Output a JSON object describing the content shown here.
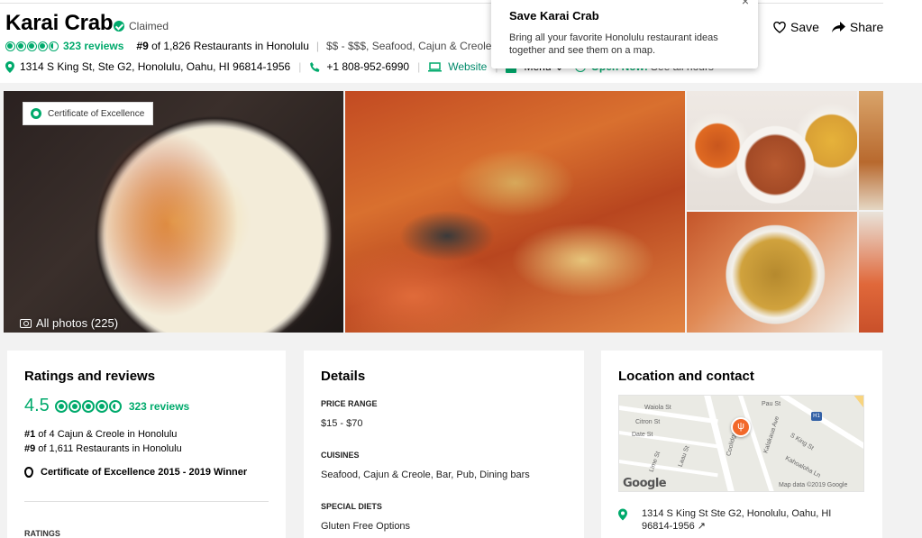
{
  "header": {
    "title": "Karai Crab",
    "claimed_label": "Claimed",
    "reviews_count": "323 reviews",
    "rank_num": "#9",
    "rank_text": " of 1,826 Restaurants in Honolulu",
    "categories": "$$ - $$$, Seafood, Cajun & Creole, Bar",
    "address": "1314 S King St, Ste G2, Honolulu, Oahu, HI 96814-1956",
    "phone": "+1 808-952-6990",
    "website_label": "Website",
    "menu_label": "Menu",
    "open_now_label": "Open Now:",
    "see_hours_label": "See all hours",
    "save_label": "Save",
    "share_label": "Share",
    "rating_bubbles": 4.5,
    "accent_color": "#00aa6c"
  },
  "popup": {
    "title": "Save Karai Crab",
    "body": "Bring all your favorite Honolulu restaurant ideas together and see them on a map.",
    "close_label": "×"
  },
  "gallery": {
    "badge_label": "Certificate of Excellence",
    "all_photos_label": "All photos (225)"
  },
  "ratings_card": {
    "title": "Ratings and reviews",
    "score": "4.5",
    "reviews_count": "323 reviews",
    "rank1_num": "#1",
    "rank1_text": " of 4 Cajun & Creole in Honolulu",
    "rank2_num": "#9",
    "rank2_text": " of 1,611 Restaurants in Honolulu",
    "certificate_text": "Certificate of Excellence 2015 - 2019 Winner",
    "ratings_subheading": "RATINGS"
  },
  "details_card": {
    "title": "Details",
    "sections": [
      {
        "heading": "PRICE RANGE",
        "value": "$15 - $70"
      },
      {
        "heading": "CUISINES",
        "value": "Seafood, Cajun & Creole, Bar, Pub, Dining bars"
      },
      {
        "heading": "SPECIAL DIETS",
        "value": "Gluten Free Options"
      }
    ]
  },
  "location_card": {
    "title": "Location and contact",
    "map_logo": "Google",
    "map_data_label": "Map data ©2019 Google",
    "map_labels": [
      "Waiola St",
      "Citron St",
      "Date St",
      "Coolidge St",
      "Kalakaua Ave",
      "S King St",
      "Kahoaloha Ln",
      "Lime St",
      "Laau St",
      "Pau St"
    ],
    "highway_label": "H1",
    "address": "1314 S King St Ste G2, Honolulu, Oahu, HI 96814-1956 ↗"
  }
}
